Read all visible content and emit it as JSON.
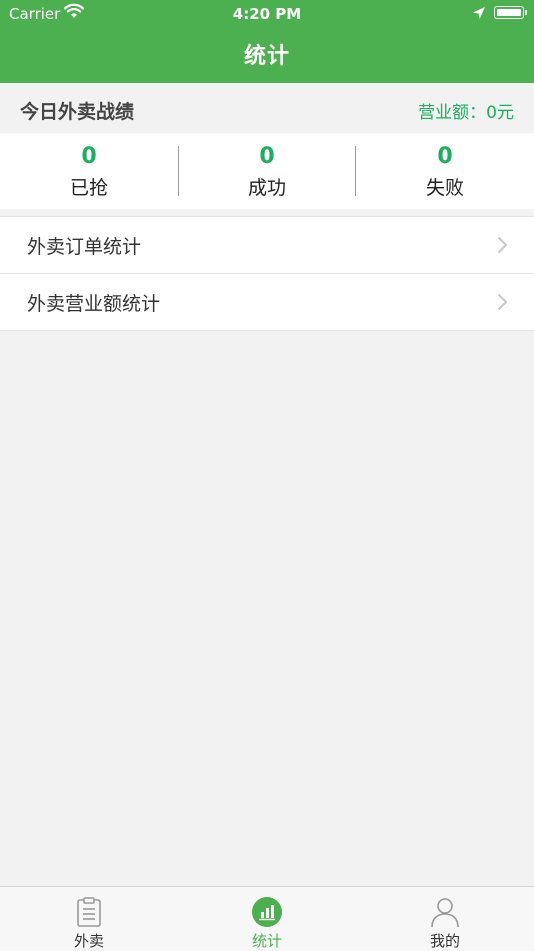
{
  "status_bar": {
    "carrier": "Carrier",
    "time": "4:20 PM"
  },
  "header": {
    "title": "统计"
  },
  "summary": {
    "title": "今日外卖战绩",
    "revenue_label": "营业额：0元"
  },
  "stats": [
    {
      "value": "0",
      "label": "已抢"
    },
    {
      "value": "0",
      "label": "成功"
    },
    {
      "value": "0",
      "label": "失败"
    }
  ],
  "menu": [
    {
      "label": "外卖订单统计"
    },
    {
      "label": "外卖营业额统计"
    }
  ],
  "tabs": [
    {
      "label": "外卖",
      "icon": "clipboard-icon"
    },
    {
      "label": "统计",
      "icon": "bar-chart-icon",
      "active": true
    },
    {
      "label": "我的",
      "icon": "user-icon"
    }
  ],
  "colors": {
    "primary": "#4caf50",
    "accent_text": "#1aaf5d",
    "background": "#f2f2f2"
  }
}
